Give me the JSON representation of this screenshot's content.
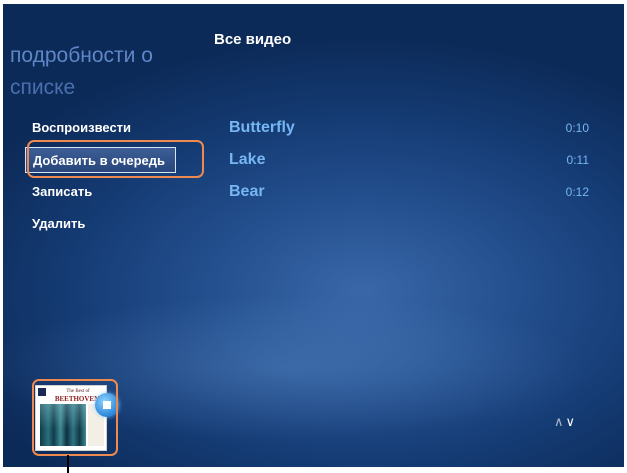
{
  "panel": {
    "title_line1": "подробности о",
    "title_line2": "списке"
  },
  "header": {
    "title": "Все видео"
  },
  "menu": {
    "items": [
      {
        "label": "Воспроизвести"
      },
      {
        "label": "Добавить в очередь",
        "selected": true
      },
      {
        "label": "Записать"
      },
      {
        "label": "Удалить"
      }
    ]
  },
  "videos": [
    {
      "title": "Butterfly",
      "duration": "0:10"
    },
    {
      "title": "Lake",
      "duration": "0:11"
    },
    {
      "title": "Bear",
      "duration": "0:12"
    }
  ],
  "now_playing": {
    "cover_caption": "The Best of",
    "cover_title": "BEETHOVEN",
    "icon": "stop-icon"
  },
  "nav": {
    "up_icon": "chevron-up-icon",
    "down_icon": "chevron-down-icon"
  },
  "colors": {
    "background": "#1a427f",
    "accent_link": "#76b6f2",
    "callout": "#ee8a4f"
  }
}
